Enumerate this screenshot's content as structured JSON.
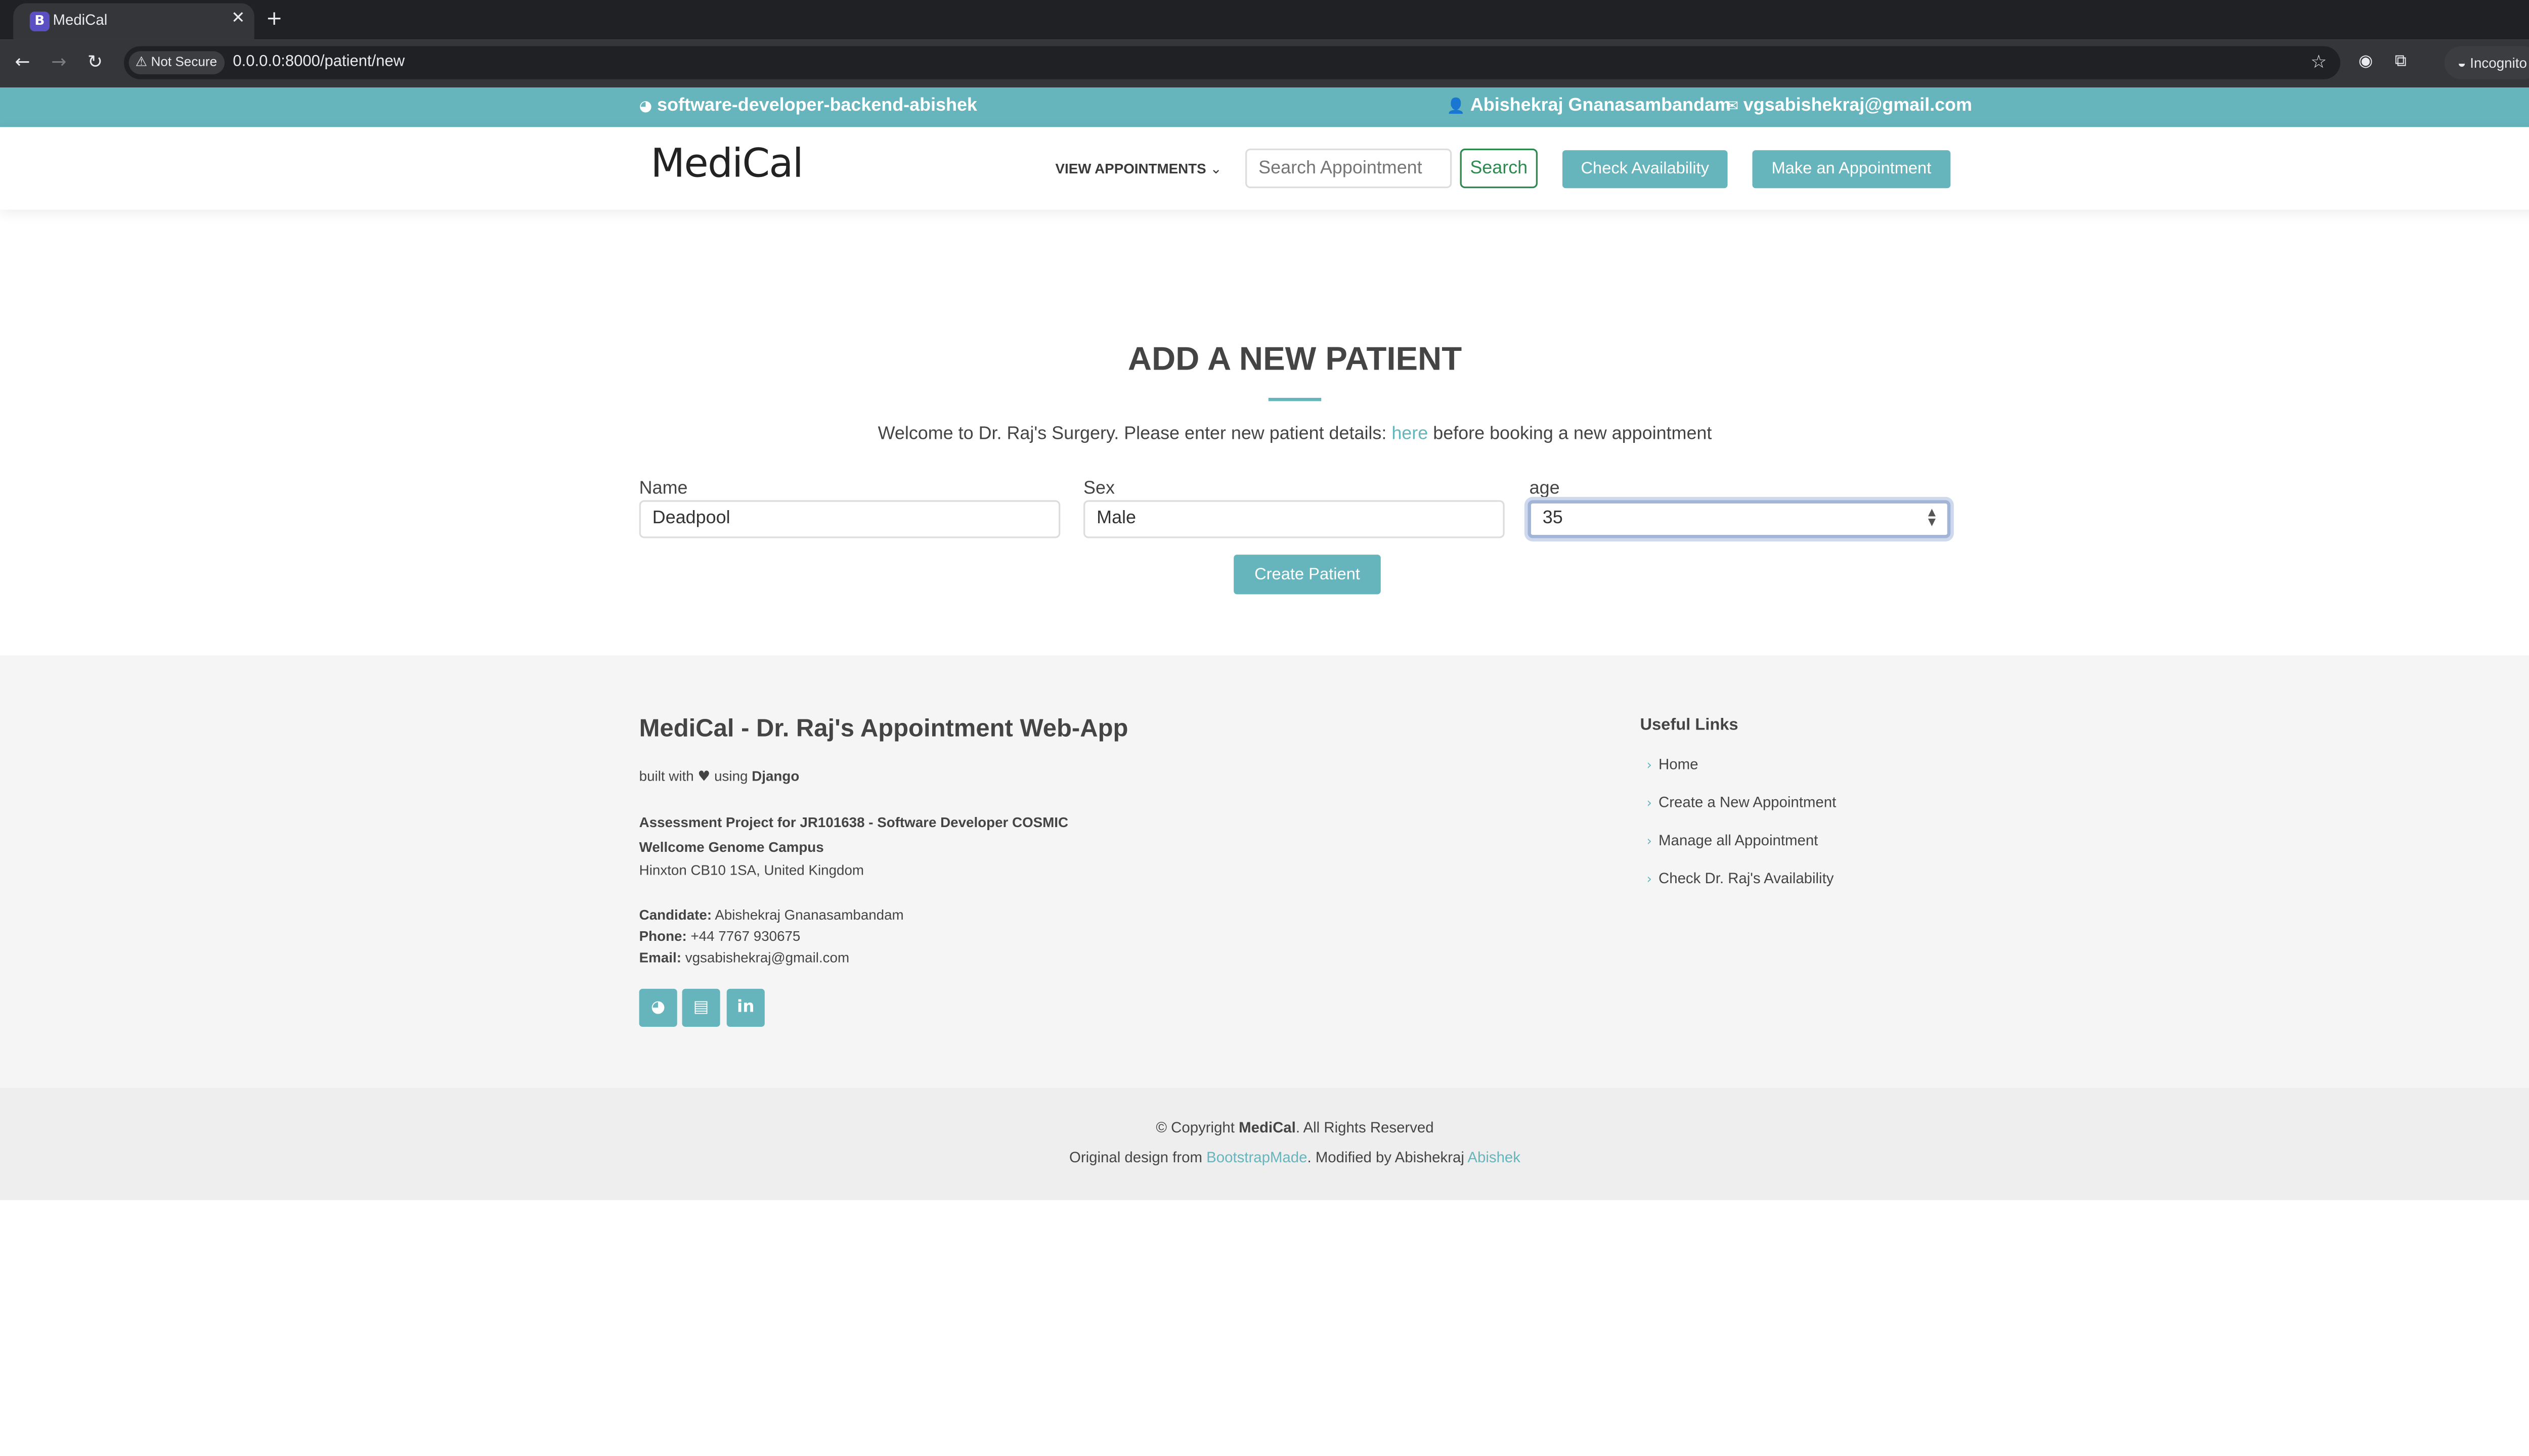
{
  "browser": {
    "tab_title": "MediCal",
    "tab_favicon": "B",
    "security_label": "Not Secure",
    "url": "0.0.0.0:8000/patient/new",
    "incognito_label": "Incognito"
  },
  "topbar": {
    "repo": "software-developer-backend-abishek",
    "user": "Abishekraj Gnanasambandam",
    "email": "vgsabishekraj@gmail.com"
  },
  "header": {
    "logo": "MediCal",
    "view_appointments": "VIEW APPOINTMENTS",
    "search_placeholder": "Search Appointment",
    "search_button": "Search",
    "check_availability": "Check Availability",
    "make_appointment": "Make an Appointment"
  },
  "main": {
    "title": "ADD A NEW PATIENT",
    "intro_before": "Welcome to Dr. Raj's Surgery. Please enter new patient details: ",
    "intro_link": "here",
    "intro_after": " before booking a new appointment",
    "fields": {
      "name_label": "Name",
      "name_value": "Deadpool",
      "sex_label": "Sex",
      "sex_value": "Male",
      "age_label": "age",
      "age_value": "35"
    },
    "create_button": "Create Patient"
  },
  "footer": {
    "title": "MediCal - Dr. Raj's Appointment Web-App",
    "built_with": "built with",
    "built_using": "using",
    "built_framework": "Django",
    "assessment": "Assessment Project for JR101638 - Software Developer COSMIC",
    "campus": "Wellcome Genome Campus",
    "address": "Hinxton CB10 1SA, United Kingdom",
    "candidate_label": "Candidate:",
    "candidate_value": "Abishekraj Gnanasambandam",
    "phone_label": "Phone:",
    "phone_value": "+44 7767 930675",
    "email_label": "Email:",
    "email_value": "vgsabishekraj@gmail.com",
    "useful_links_title": "Useful Links",
    "useful_links": [
      "Home",
      "Create a New Appointment",
      "Manage all Appointment",
      "Check Dr. Raj's Availability"
    ],
    "copyright_prefix": "© Copyright ",
    "copyright_brand": "MediCal",
    "copyright_suffix": ". All Rights Reserved",
    "credits_prefix": "Original design from ",
    "credits_link": "BootstrapMade",
    "credits_middle": ". Modified by Abishekraj ",
    "credits_author_link": "Abishek"
  },
  "colors": {
    "accent": "#66b5bc",
    "search_border": "#2d8a4f"
  }
}
